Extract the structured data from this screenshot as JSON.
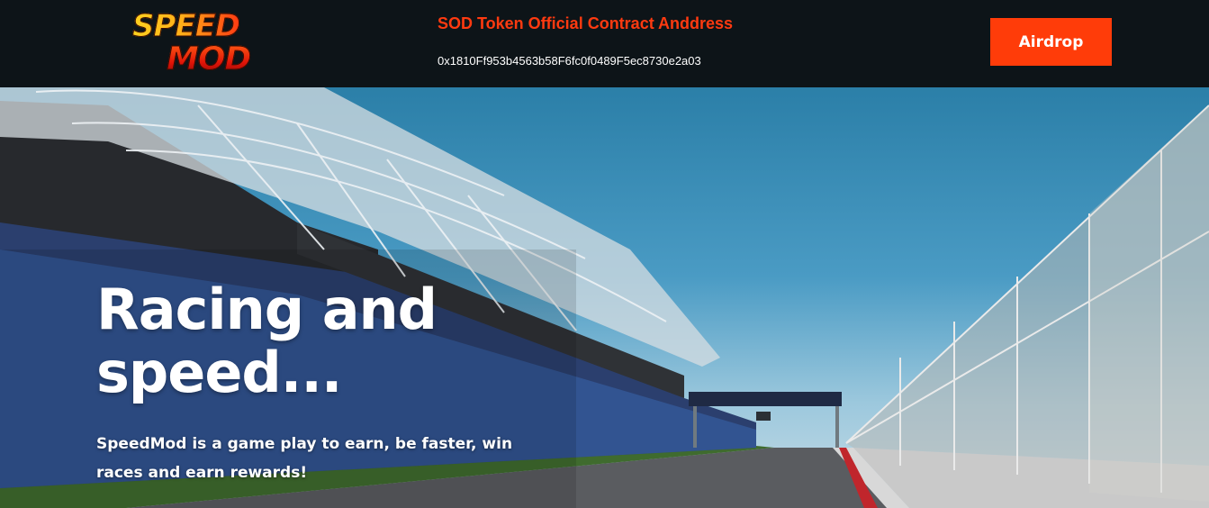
{
  "header": {
    "logo": {
      "line1": "SPEED",
      "line2": "MOD"
    },
    "contract_title": "SOD Token Official Contract Anddress",
    "contract_address": "0x1810Ff953b4563b58F6fc0f0489F5ec8730e2a03",
    "airdrop_label": "Airdrop"
  },
  "hero": {
    "title": "Racing and speed...",
    "subtitle": "SpeedMod is a game play to earn, be faster, win races and earn rewards!"
  },
  "colors": {
    "accent": "#ff3c09",
    "background": "#0d1418",
    "text": "#ffffff"
  }
}
